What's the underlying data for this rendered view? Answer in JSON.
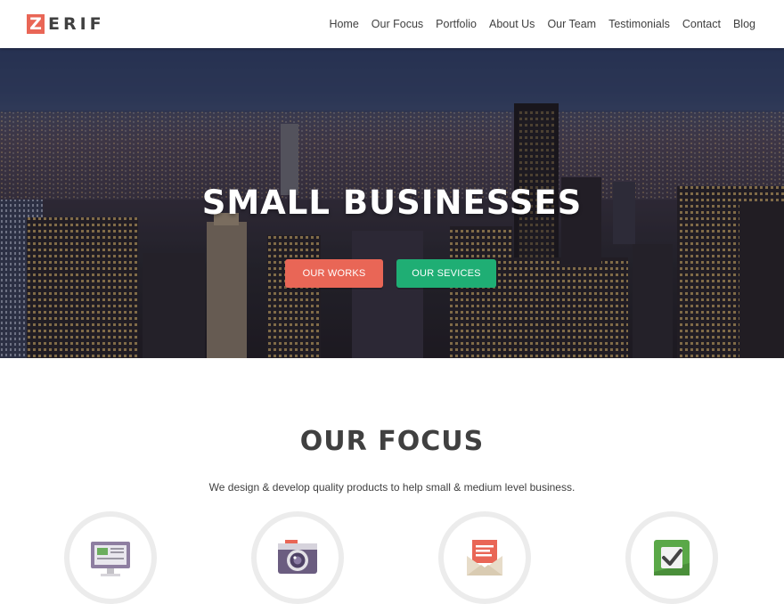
{
  "header": {
    "logo_letter": "Z",
    "logo_rest": "ERIF",
    "nav": [
      "Home",
      "Our Focus",
      "Portfolio",
      "About Us",
      "Our Team",
      "Testimonials",
      "Contact",
      "Blog"
    ]
  },
  "hero": {
    "title": "SMALL BUSINESSES",
    "button_works": "OUR WORKS",
    "button_services": "OUR SEVICES"
  },
  "focus": {
    "title": "OUR FOCUS",
    "subtitle": "We design & develop quality products to help small & medium level business.",
    "items": [
      {
        "icon": "monitor-icon"
      },
      {
        "icon": "camera-icon"
      },
      {
        "icon": "mail-icon"
      },
      {
        "icon": "checkmark-icon"
      }
    ]
  },
  "colors": {
    "accent_red": "#e96656",
    "accent_green": "#1fae74",
    "text_dark": "#404040"
  }
}
